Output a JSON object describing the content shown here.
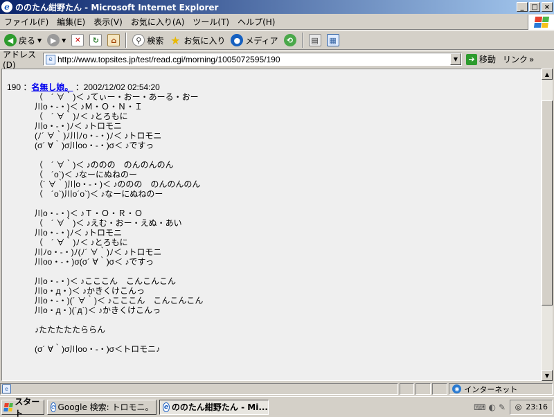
{
  "window": {
    "title": "ののたん紺野たん - Microsoft Internet Explorer",
    "btn_min": "_",
    "btn_max": "□",
    "btn_close": "×"
  },
  "menu": [
    "ファイル(F)",
    "編集(E)",
    "表示(V)",
    "お気に入り(A)",
    "ツール(T)",
    "ヘルプ(H)"
  ],
  "toolbar": {
    "back": "戻る",
    "search": "検索",
    "favorites": "お気に入り",
    "media": "メディア"
  },
  "address": {
    "label": "アドレス(D)",
    "url": "http://www.topsites.jp/test/read.cgi/morning/1005072595/190",
    "go": "移動",
    "links": "リンク"
  },
  "post": {
    "number": "190",
    "separator": "：",
    "name": "名無し娘。",
    "date": "：2002/12/02 02:54:20",
    "lines": [
      "（　´ ∀｀)＜ ♪てぃー・おー・あーる・おー",
      "川o・-・)＜ ♪Ｍ・Ｏ・Ｎ・Ｉ",
      "（　´ ∀｀)ﾉ＜ ♪とろもに",
      "川o・-・)ﾉ＜ ♪トロモニ",
      "(ﾉ´ ∀｀)ﾉ川ﾉo・-・)ﾉ＜ ♪トロモニ",
      "(σ´ ∀｀)σ川oo・-・)σ＜ ♪ですっ",
      "",
      "（　´ ∀｀)＜ ♪ののの　のんのんのん",
      "（　´o`)＜ ♪なーにぬねのー",
      "（´ ∀｀)川o・-・)＜ ♪ののの　のんのんのん",
      "（　´o`)川o´o`)＜ ♪なーにぬねのー",
      "",
      "川o・-・)＜ ♪Ｔ・Ｏ・Ｒ・Ｏ",
      "（　´ ∀｀)＜ ♪えむ・おー・えぬ・あい",
      "川o・-・)ﾉ＜ ♪トロモニ",
      "（　´ ∀｀)ﾉ＜ ♪とろもに",
      "川ﾉo・-・)ﾉ(ﾉ´ ∀｀)ﾉ＜ ♪トロモニ",
      "川oo・-・)σ(σ´ ∀｀)σ＜ ♪ですっ",
      "",
      "川o・-・)＜ ♪こここん　こんこんこん",
      "川o・д・)＜ ♪かきくけこんっ",
      "川o・-・)(´ ∀｀)＜ ♪こここん　こんこんこん",
      "川o・д・)(´д`)＜ ♪かきくけこんっ",
      "",
      "♪たたたたたららん",
      "",
      "(σ´ ∀｀)σ川oo・-・)σ＜トロモニ♪"
    ]
  },
  "status": {
    "zone": "インターネット"
  },
  "taskbar": {
    "start": "スタート",
    "task1": "Google 検索: トロモニ。 - ...",
    "task2": "ののたん紺野たん - Mi...",
    "clock": "23:16"
  },
  "colors": {
    "title_start": "#0a246a",
    "title_end": "#a6caf0",
    "link": "#0000ee",
    "content_bg": "#efefef"
  }
}
